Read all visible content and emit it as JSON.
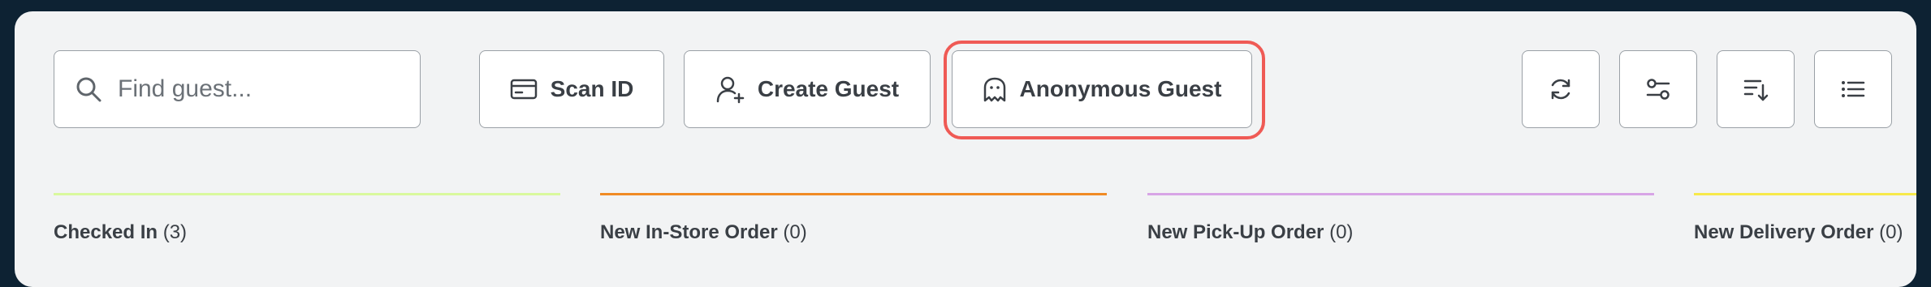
{
  "toolbar": {
    "search": {
      "placeholder": "Find guest...",
      "value": ""
    },
    "scan_id_label": "Scan ID",
    "create_guest_label": "Create Guest",
    "anonymous_guest_label": "Anonymous Guest",
    "icons": [
      "refresh-icon",
      "filter-icon",
      "sort-icon",
      "list-view-icon"
    ]
  },
  "columns": [
    {
      "title": "Checked In",
      "count": "(3)",
      "color": "#d9f99d"
    },
    {
      "title": "New In-Store Order",
      "count": "(0)",
      "color": "#f08a24"
    },
    {
      "title": "New Pick-Up Order",
      "count": "(0)",
      "color": "#d8a5e6"
    },
    {
      "title": "New Delivery Order",
      "count": "(0)",
      "color": "#f7e94a"
    }
  ],
  "colors": {
    "highlight": "#ef5a55",
    "background": "#0d2233",
    "panel": "#f2f3f4"
  }
}
